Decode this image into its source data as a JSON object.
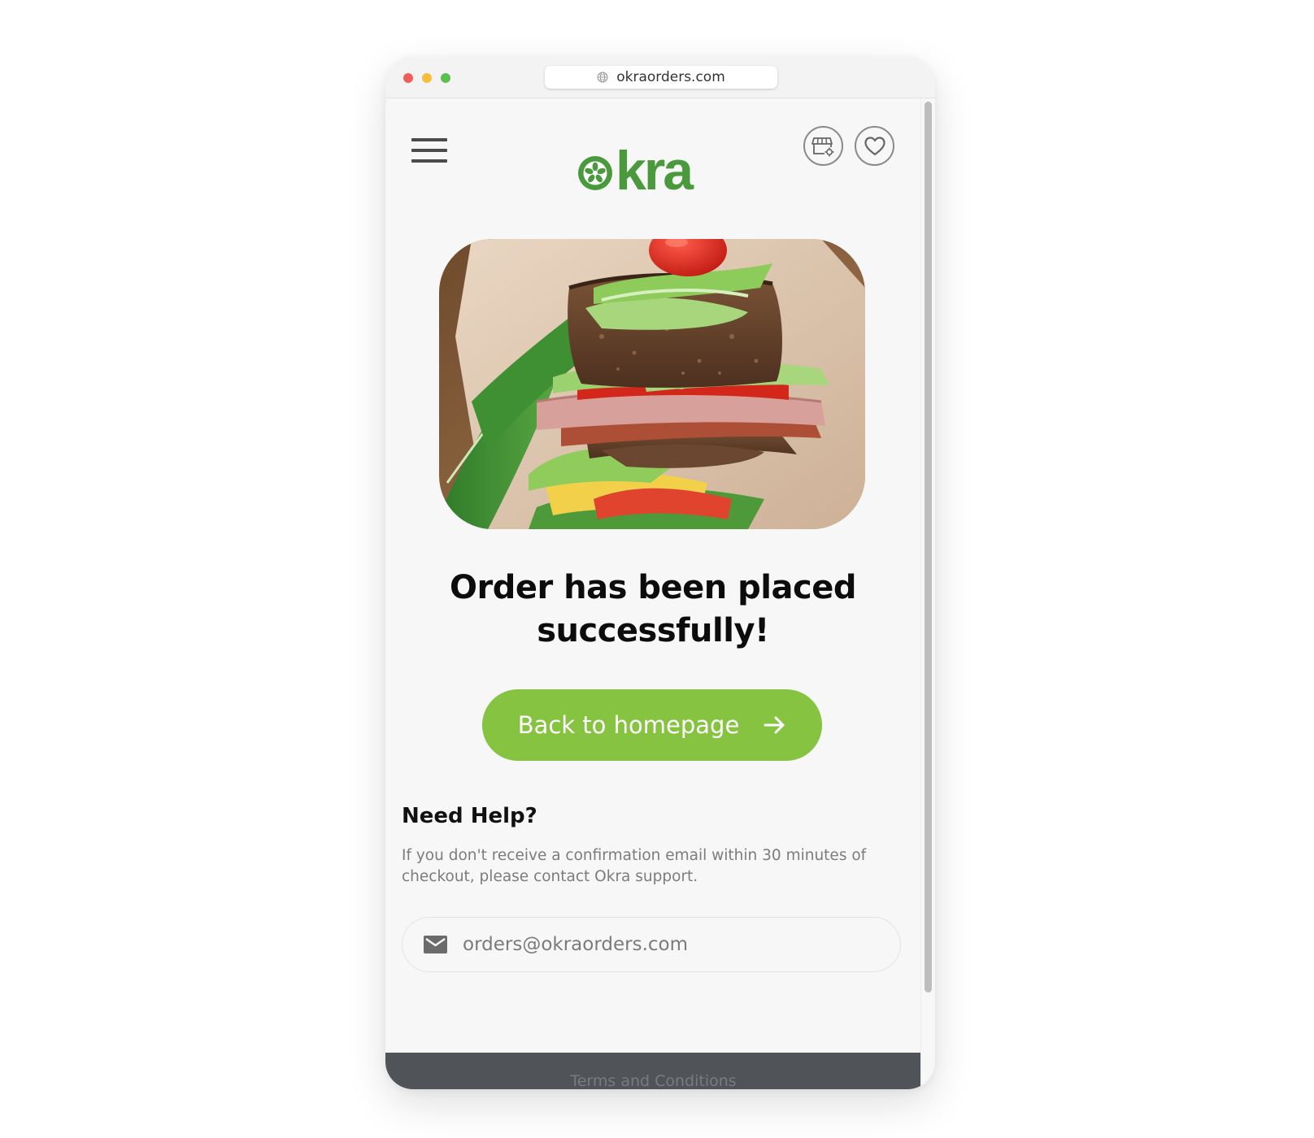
{
  "browser": {
    "url": "okraorders.com"
  },
  "header": {
    "logo_text": "okra",
    "menu_icon": "hamburger-menu-icon",
    "store_icon": "store-settings-icon",
    "favorites_icon": "heart-icon"
  },
  "hero": {
    "image_alt": "sandwich"
  },
  "confirmation": {
    "headline_line1": "Order has been placed",
    "headline_line2": "successfully!"
  },
  "cta": {
    "label": "Back to homepage",
    "icon": "arrow-right-icon"
  },
  "help": {
    "title": "Need Help?",
    "text_line1": "If you don't receive a confirmation email within 30 minutes of",
    "text_line2": "checkout, please contact Okra support.",
    "email": "orders@okraorders.com",
    "email_icon": "mail-icon"
  },
  "footer": {
    "link": "Terms and Conditions"
  },
  "colors": {
    "brand_green": "#85c341",
    "logo_green": "#4a9a3d",
    "footer_bg": "#505458"
  }
}
